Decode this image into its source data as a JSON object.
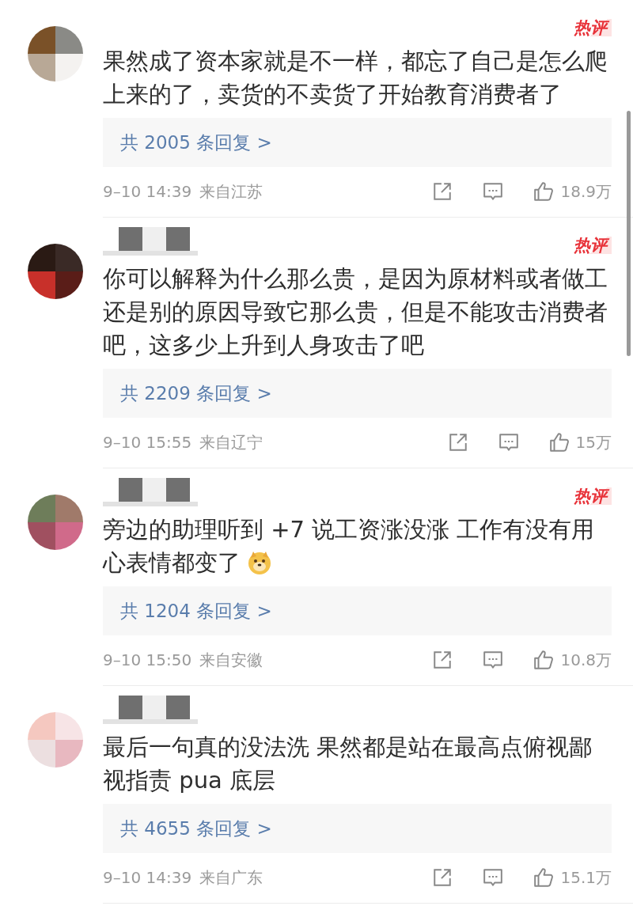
{
  "comments": [
    {
      "badge": "热评",
      "text": "果然成了资本家就是不一样，都忘了自己是怎么爬上来的了，卖货的不卖货了开始教育消费者了",
      "emoji": false,
      "replies": "共 2005 条回复 >",
      "time": "9–10 14:39",
      "location": "来自江苏",
      "likes": "18.9万"
    },
    {
      "badge": "热评",
      "text": "你可以解释为什么那么贵，是因为原材料或者做工还是别的原因导致它那么贵，但是不能攻击消费者吧，这多少上升到人身攻击了吧",
      "emoji": false,
      "replies": "共 2209 条回复 >",
      "time": "9–10 15:55",
      "location": "来自辽宁",
      "likes": "15万"
    },
    {
      "badge": "热评",
      "text": "旁边的助理听到 +7 说工资涨没涨 工作有没有用心表情都变了",
      "emoji": true,
      "replies": "共 1204 条回复 >",
      "time": "9–10 15:50",
      "location": "来自安徽",
      "likes": "10.8万"
    },
    {
      "text": "最后一句真的没法洗 果然都是站在最高点俯视鄙视指责 pua 底层",
      "emoji": false,
      "replies": "共 4655 条回复 >",
      "time": "9–10 14:39",
      "location": "来自广东",
      "likes": "15.1万"
    }
  ]
}
